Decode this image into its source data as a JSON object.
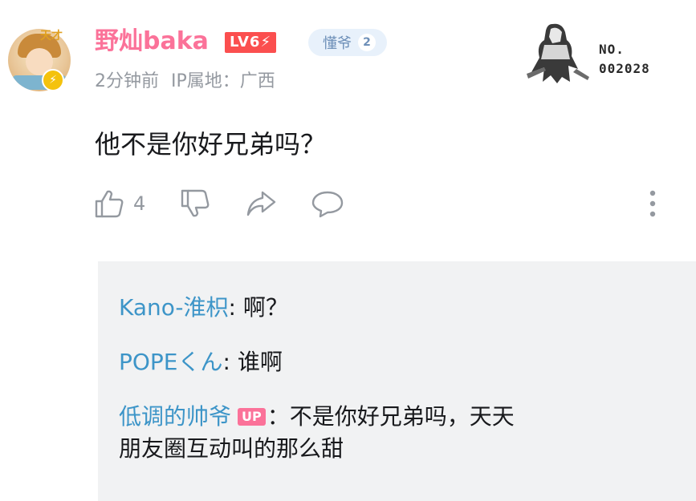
{
  "comment": {
    "author": {
      "username": "野灿baka",
      "level": "LV6",
      "level_suffix": "⚡",
      "fan_badge_name": "懂爷",
      "fan_badge_level": "2",
      "avatar_tag": "天才",
      "avatar_badge_icon": "lightning-icon"
    },
    "time": "2分钟前",
    "ip_location": "IP属地：广西",
    "content": "他不是你好兄弟吗？",
    "like_count": "4",
    "decoration": {
      "label_line1": "NO.",
      "label_line2": "002028"
    },
    "colors": {
      "username": "#fb7299",
      "level_badge": "#fb4f4f",
      "reply_name": "#3d95c8",
      "up_badge": "#fb7299"
    }
  },
  "replies": [
    {
      "username": "Kano-淮枳",
      "separator": ": ",
      "content": "啊？"
    },
    {
      "username": "POPEくん",
      "separator": ": ",
      "content": "谁啊"
    },
    {
      "username": "低调的帅爷",
      "badge": "UP",
      "separator": "：",
      "content_line1": "不是你好兄弟吗，天天",
      "content_line2": "朋友圈互动叫的那么甜"
    }
  ]
}
